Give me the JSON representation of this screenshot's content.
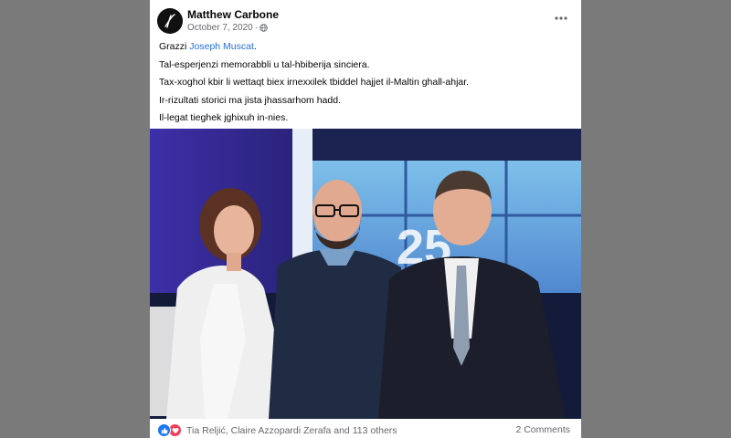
{
  "post": {
    "author": "Matthew Carbone",
    "date": "October 7, 2020",
    "separator": "·",
    "privacy_icon": "globe-icon",
    "menu_icon": "more-horizontal-icon",
    "text": {
      "line1_prefix": "Grazzi ",
      "mention": "Joseph Muscat",
      "line1_suffix": ".",
      "line2": "Tal-esperjenzi memorabbli u tal-hbiberija sinciera.",
      "line3": "Tax-xoghol kbir li wettaqt biex irnexxilek tbiddel hajjet il-Maltin ghall-ahjar.",
      "line4": "Ir-rizultati storici ma jista jhassarhom hadd.",
      "line5": "Il-legat tieghek jghixuh in-nies."
    },
    "photo": {
      "screen_text": "25"
    },
    "footer": {
      "reaction_icons": [
        "like-icon",
        "love-icon"
      ],
      "reactions_text": "Tia Reljić, Claire Azzopardi Zerafa and 113 others",
      "comments": "2 Comments"
    }
  },
  "colors": {
    "backdrop": "#7a7a7a",
    "card": "#ffffff",
    "link": "#216fdb",
    "secondary_text": "#65676b",
    "like": "#1877f2",
    "love": "#f33e58"
  }
}
